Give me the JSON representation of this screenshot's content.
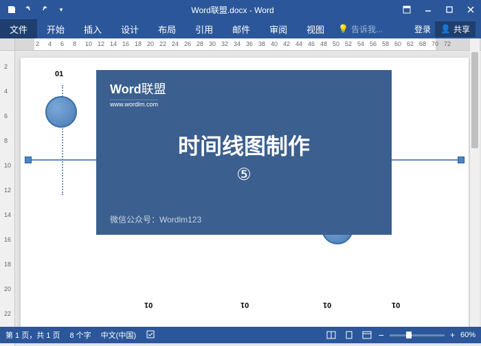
{
  "titlebar": {
    "doc": "Word联盟.docx - Word"
  },
  "tabs": {
    "file": "文件",
    "home": "开始",
    "insert": "插入",
    "design": "设计",
    "layout": "布局",
    "ref": "引用",
    "mail": "邮件",
    "review": "审阅",
    "view": "视图",
    "tell": "告诉我...",
    "login": "登录",
    "share": "共享"
  },
  "ruler_h": [
    "2",
    "4",
    "6",
    "8",
    "10",
    "12",
    "14",
    "16",
    "18",
    "20",
    "22",
    "24",
    "26",
    "28",
    "30",
    "32",
    "34",
    "36",
    "38",
    "40",
    "42",
    "44",
    "46",
    "48",
    "50",
    "52",
    "54",
    "56",
    "58",
    "60",
    "62",
    "68",
    "70",
    "72"
  ],
  "ruler_v": [
    "2",
    "4",
    "6",
    "8",
    "10",
    "12",
    "14",
    "16",
    "18",
    "20",
    "22"
  ],
  "doc": {
    "label": "01"
  },
  "overlay": {
    "logo_bold": "Word",
    "logo_rest": "联盟",
    "url": "www.wordlm.com",
    "title": "时间线图制作",
    "num": "⑤",
    "footer": "微信公众号：Wordlm123"
  },
  "status": {
    "page": "第 1 页，共 1 页",
    "words": "8 个字",
    "lang": "中文(中国)",
    "zoom": "60%"
  },
  "colors": {
    "brand": "#2b579a",
    "overlay": "#3b5f8f"
  }
}
